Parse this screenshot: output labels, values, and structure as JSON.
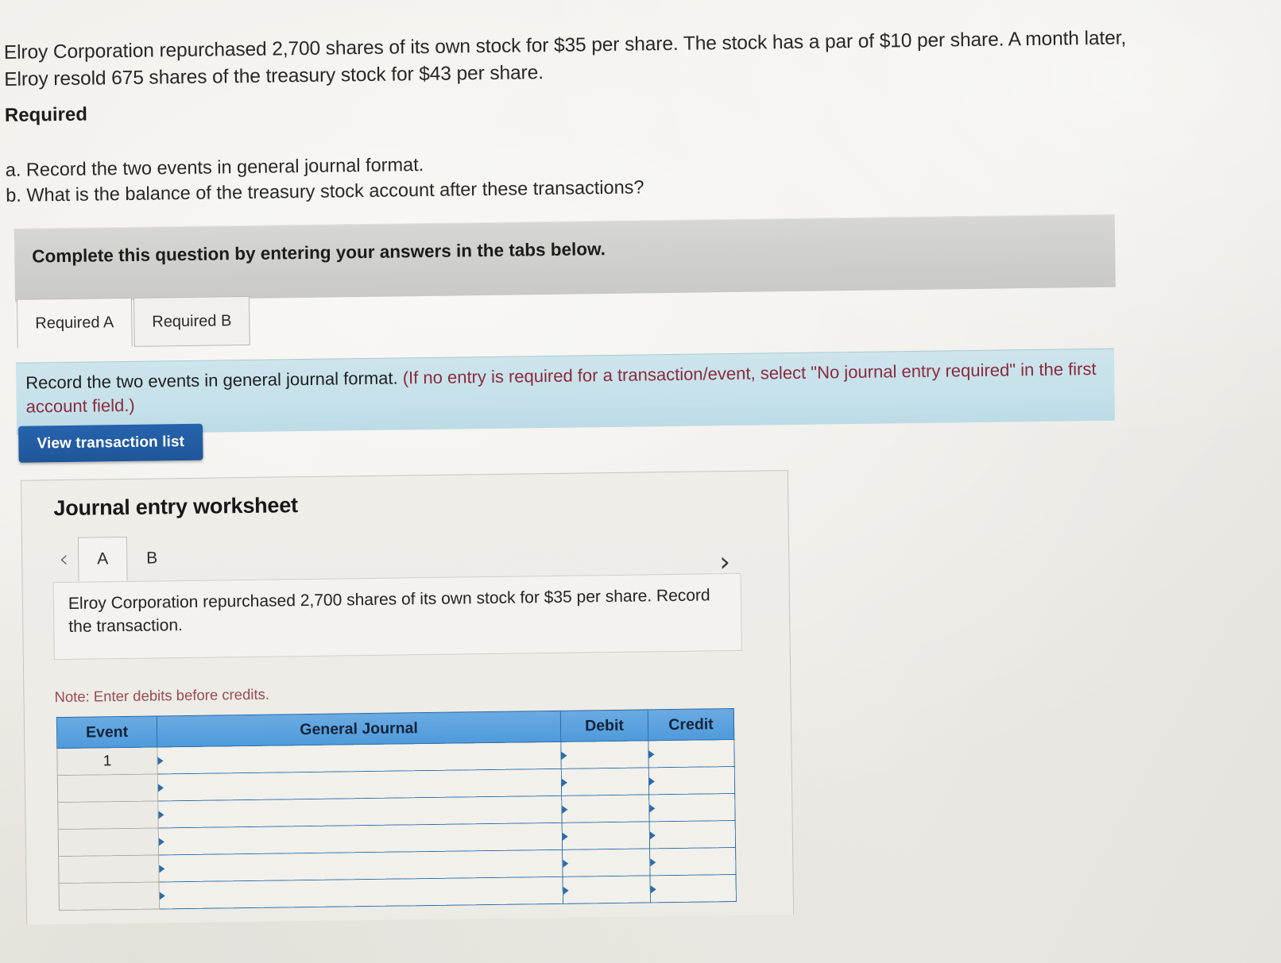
{
  "question": {
    "prompt": "Elroy Corporation repurchased 2,700 shares of its own stock for $35 per share. The stock has a par of $10 per share. A month later, Elroy resold 675 shares of the treasury stock for $43 per share.",
    "required_heading": "Required",
    "requirement_a": "a. Record the two events in general journal format.",
    "requirement_b": "b. What is the balance of the treasury stock account after these transactions?"
  },
  "banner": {
    "instruction": "Complete this question by entering your answers in the tabs below."
  },
  "required_tabs": [
    {
      "label": "Required A",
      "active": true
    },
    {
      "label": "Required B",
      "active": false
    }
  ],
  "blue_banner": {
    "bold_part": "Record the two events in general journal format.",
    "paren_part": "(If no entry is required for a transaction/event, select \"No journal entry required\" in the first account field.)"
  },
  "buttons": {
    "view_transaction_list": "View transaction list"
  },
  "worksheet": {
    "title": "Journal entry worksheet",
    "prev_icon": "chevron-left-icon",
    "next_icon": "chevron-right-icon",
    "letter_tabs": [
      {
        "label": "A",
        "active": true
      },
      {
        "label": "B",
        "active": false
      }
    ],
    "transaction_text": "Elroy Corporation repurchased 2,700 shares of its own stock for $35 per share. Record the transaction.",
    "note": "Note: Enter debits before credits.",
    "table": {
      "headers": [
        "Event",
        "General Journal",
        "Debit",
        "Credit"
      ],
      "rows": [
        {
          "event": "1",
          "general_journal": "",
          "debit": "",
          "credit": ""
        },
        {
          "event": "",
          "general_journal": "",
          "debit": "",
          "credit": ""
        },
        {
          "event": "",
          "general_journal": "",
          "debit": "",
          "credit": ""
        },
        {
          "event": "",
          "general_journal": "",
          "debit": "",
          "credit": ""
        },
        {
          "event": "",
          "general_journal": "",
          "debit": "",
          "credit": ""
        },
        {
          "event": "",
          "general_journal": "",
          "debit": "",
          "credit": ""
        }
      ]
    }
  },
  "colors": {
    "button_blue": "#1f5699",
    "table_header_blue": "#4e9adb",
    "table_border_blue": "#2b6ca8",
    "blue_banner_bg": "#c6e1ea",
    "gray_banner_bg": "#cfcfcb",
    "note_red": "#9b4a55",
    "page_bg": "#eeece6"
  }
}
